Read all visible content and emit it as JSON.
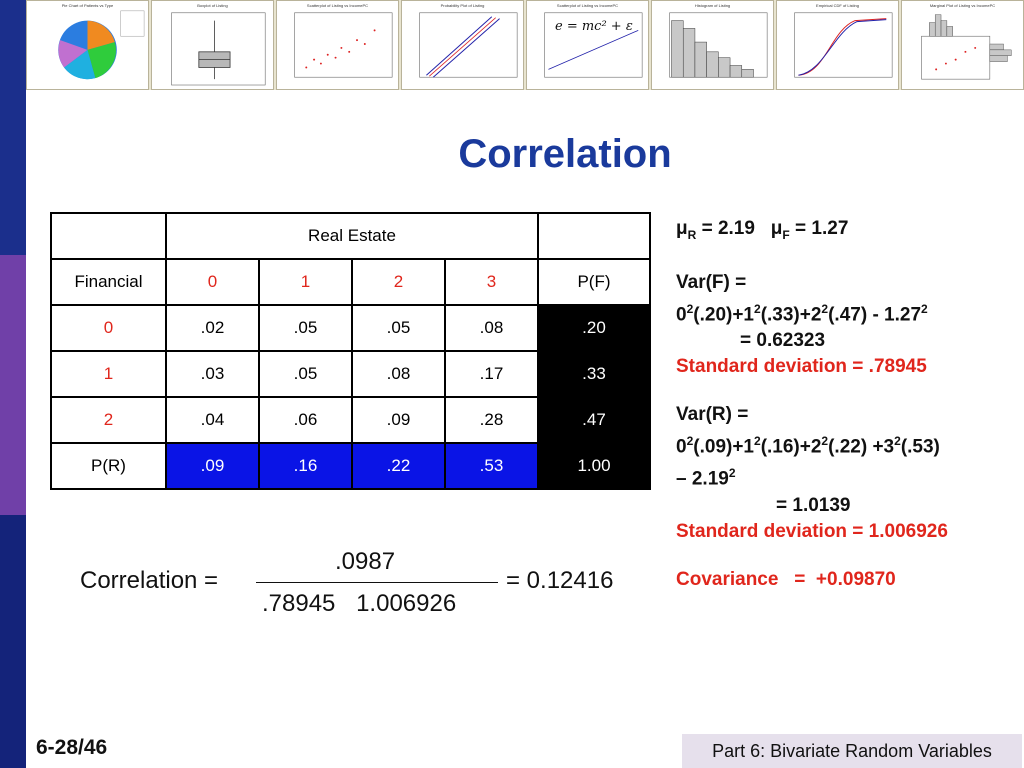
{
  "thumbnails": [
    {
      "title": "Pie Chart of Patients vs Type"
    },
    {
      "title": "Boxplot of Listing"
    },
    {
      "title": "Scatterplot of Listing vs IncomePC"
    },
    {
      "title": "Probability Plot of Listing"
    },
    {
      "title": "Scatterplot of Listing vs IncomePC",
      "formula": "e = mc² + ε"
    },
    {
      "title": "Histogram of Listing"
    },
    {
      "title": "Empirical CDF of Listing"
    },
    {
      "title": "Marginal Plot of Listing vs IncomePC"
    }
  ],
  "title": "Correlation",
  "table": {
    "header_real_estate": "Real Estate",
    "row_label_header": "Financial",
    "columns": [
      "0",
      "1",
      "2",
      "3"
    ],
    "marginal_f_label": "P(F)",
    "rows": [
      {
        "label": "0",
        "values": [
          ".02",
          ".05",
          ".05",
          ".08"
        ],
        "pf": ".20"
      },
      {
        "label": "1",
        "values": [
          ".03",
          ".05",
          ".08",
          ".17"
        ],
        "pf": ".33"
      },
      {
        "label": "2",
        "values": [
          ".04",
          ".06",
          ".09",
          ".28"
        ],
        "pf": ".47"
      }
    ],
    "pr_label": "P(R)",
    "pr_values": [
      ".09",
      ".16",
      ".22",
      ".53"
    ],
    "total": "1.00"
  },
  "notes": {
    "mu_r_prefix": "μ",
    "mu_r_sub": "R",
    "mu_r_value": " = 2.19",
    "mu_f_prefix": "μ",
    "mu_f_sub": "F",
    "mu_f_value": " = 1.27",
    "varf_label": "Var(F) =",
    "varf_result": "= 0.62323",
    "varf_sd": "Standard deviation = .78945",
    "varr_label": "Var(R) =",
    "varr_result": "= 1.0139",
    "varr_sd": "Standard deviation = 1.006926",
    "covariance": "Covariance   =  +0.09870"
  },
  "formula": {
    "label": "Correlation =",
    "numerator": ".0987",
    "denominator": ".78945 1.006926",
    "result": "= 0.12416"
  },
  "footer": {
    "page": "6-28/46",
    "section": "Part 6: Bivariate Random Variables"
  }
}
